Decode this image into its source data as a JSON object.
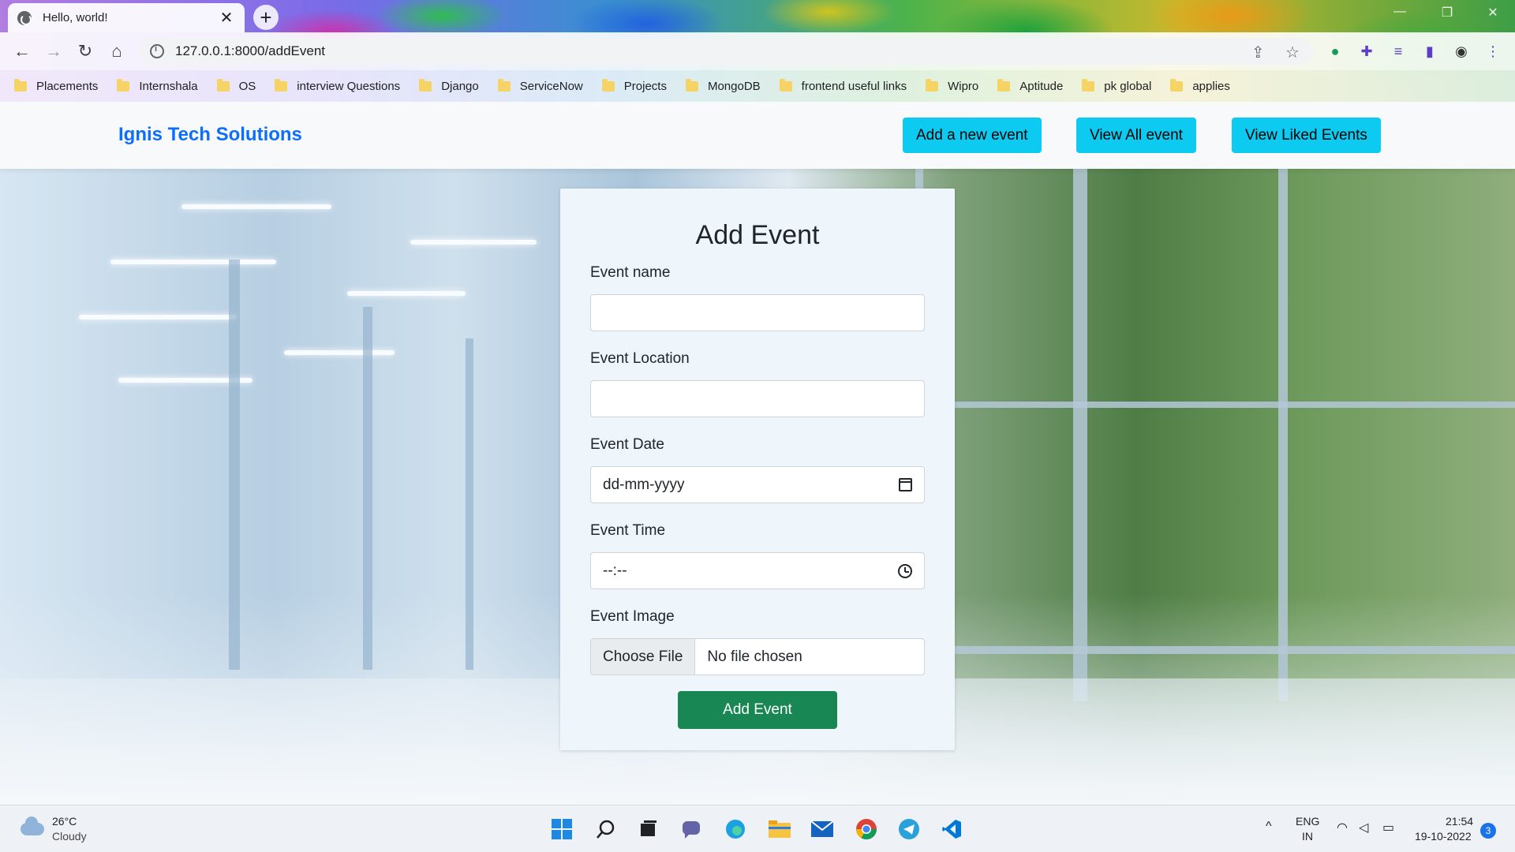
{
  "browser": {
    "tab_title": "Hello, world!",
    "url": "127.0.0.1:8000/addEvent",
    "bookmarks": [
      "Placements",
      "Internshala",
      "OS",
      "interview Questions",
      "Django",
      "ServiceNow",
      "Projects",
      "MongoDB",
      "frontend useful links",
      "Wipro",
      "Aptitude",
      "pk global",
      "applies"
    ]
  },
  "navbar": {
    "brand": "Ignis Tech Solutions",
    "buttons": [
      "Add a new event",
      "View All event",
      "View Liked Events"
    ]
  },
  "form": {
    "title": "Add Event",
    "fields": {
      "name_label": "Event name",
      "location_label": "Event Location",
      "date_label": "Event Date",
      "date_placeholder": "dd-mm-yyyy",
      "time_label": "Event Time",
      "time_placeholder": "--:--",
      "image_label": "Event Image",
      "choose_file": "Choose File",
      "no_file": "No file chosen"
    },
    "submit_label": "Add Event"
  },
  "taskbar": {
    "weather_temp": "26°C",
    "weather_desc": "Cloudy",
    "lang_line1": "ENG",
    "lang_line2": "IN",
    "time": "21:54",
    "date": "19-10-2022",
    "notification_count": "3"
  },
  "colors": {
    "brand": "#0d6efd",
    "nav_button": "#0dcaf0",
    "submit_button": "#198754"
  }
}
